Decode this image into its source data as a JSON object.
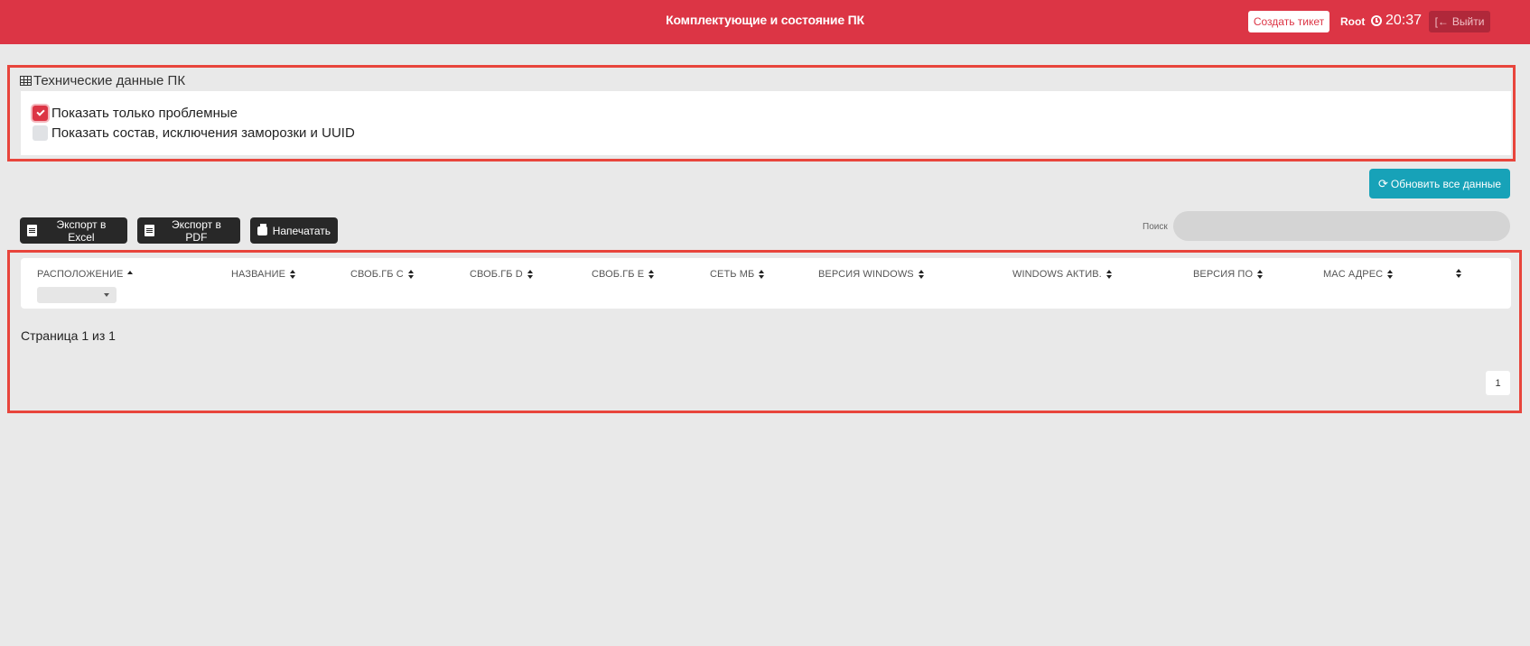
{
  "header": {
    "title": "Комплектующие и состояние ПК",
    "create_ticket": "Создать тикет",
    "user": "Root",
    "time": "20:37",
    "logout": "Выйти"
  },
  "tech_panel": {
    "title": "Технические данные ПК",
    "options": [
      {
        "label": "Показать только проблемные",
        "checked": true
      },
      {
        "label": "Показать состав, исключения заморозки и UUID",
        "checked": false
      }
    ]
  },
  "toolbar": {
    "refresh": "Обновить все данные",
    "export_excel": "Экспорт в Excel",
    "export_pdf": "Экспорт в PDF",
    "print": "Напечатать",
    "search_label": "Поиск",
    "search_value": ""
  },
  "table": {
    "columns": [
      "РАСПОЛОЖЕНИЕ",
      "НАЗВАНИЕ",
      "СВОБ.ГБ C",
      "СВОБ.ГБ D",
      "СВОБ.ГБ E",
      "СЕТЬ МБ",
      "ВЕРСИЯ WINDOWS",
      "WINDOWS АКТИВ.",
      "ВЕРСИЯ ПО",
      "MAC АДРЕС",
      ""
    ],
    "rows": []
  },
  "pagination": {
    "info": "Страница 1 из 1",
    "current": "1"
  },
  "colors": {
    "header_bg": "#dc3545",
    "refresh_bg": "#17a2b8",
    "export_bg": "#282828",
    "highlight_border": "#e8453c"
  }
}
